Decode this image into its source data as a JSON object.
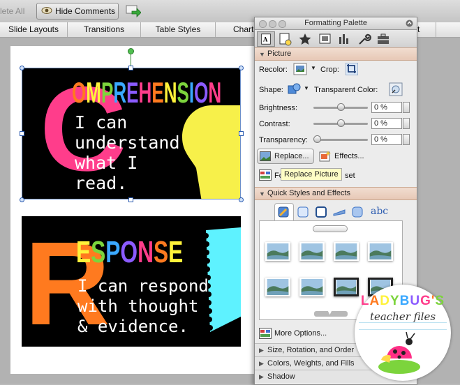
{
  "toolbar": {
    "delete_all_label": "lete All",
    "hide_comments_label": "Hide Comments"
  },
  "ribbon": {
    "tabs": [
      "Slide Layouts",
      "Transitions",
      "Table Styles",
      "Charts"
    ],
    "partial_tab": "rt"
  },
  "slide": {
    "card1": {
      "big_letter": "C",
      "title_letters": [
        "O",
        "M",
        "P",
        "R",
        "E",
        "H",
        "E",
        "N",
        "S",
        "I",
        "O",
        "N"
      ],
      "body_lines": [
        "I can",
        "understand",
        "what I",
        "read."
      ]
    },
    "card2": {
      "big_letter": "R",
      "title_letters": [
        "E",
        "S",
        "P",
        "O",
        "N",
        "S",
        "E"
      ],
      "body_lines": [
        "I can respond",
        "with thought",
        "& evidence."
      ]
    }
  },
  "palette": {
    "title": "Formatting Palette",
    "picture_section": "Picture",
    "recolor_label": "Recolor:",
    "crop_label": "Crop:",
    "shape_label": "Shape:",
    "transparent_color_label": "Transparent Color:",
    "brightness_label": "Brightness:",
    "brightness_value": "0 %",
    "contrast_label": "Contrast:",
    "contrast_value": "0 %",
    "transparency_label": "Transparency:",
    "transparency_value": "0 %",
    "replace_label": "Replace...",
    "effects_label": "Effects...",
    "format_partial": "Fo",
    "reset_partial": "set",
    "tooltip": "Replace Picture",
    "quick_styles_section": "Quick Styles and Effects",
    "abc_label": "abc",
    "more_options_label": "More Options...",
    "size_section": "Size, Rotation, and Order",
    "colors_section": "Colors, Weights, and Fills",
    "shadow_section": "Shadow"
  },
  "watermark": {
    "title": "LADYBUG'S",
    "subtitle": "teacher files"
  },
  "colors": {
    "pink": "#ff3d8b",
    "orange": "#ff7a1f",
    "yellow": "#fff23a",
    "green": "#7cd43c",
    "blue": "#3aa8ff",
    "purple": "#8b5bff",
    "cyan": "#5ef2ff",
    "bulb": "#f7f04a"
  }
}
